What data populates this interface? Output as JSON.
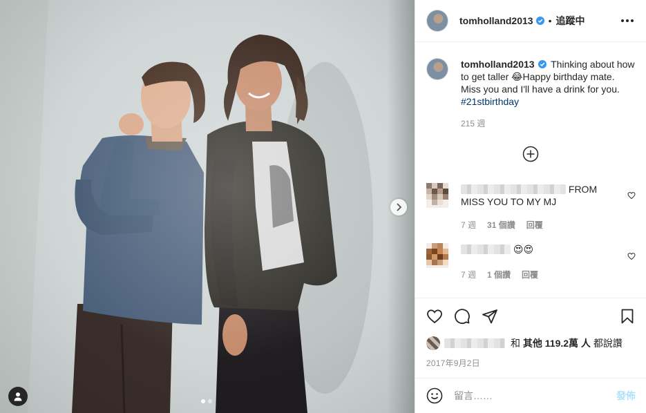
{
  "post": {
    "username": "tomholland2013",
    "follow_status": "追蹤中",
    "separator": "•",
    "verified": true
  },
  "caption": {
    "username": "tomholland2013",
    "text": "Thinking about how to get taller 😂Happy birthday mate. Miss you and I'll have a drink for you.",
    "hashtag": "#21stbirthday",
    "time": "215 週"
  },
  "comments": [
    {
      "text_suffix": "FROM",
      "text_line2": "MISS YOU TO MY MJ",
      "time": "7 週",
      "likes": "31 個讚",
      "reply": "回覆"
    },
    {
      "text_suffix": "😍😍",
      "time": "7 週",
      "likes": "1 個讚",
      "reply": "回覆"
    }
  ],
  "likes": {
    "prefix": "和",
    "others": "其他 119.2萬 人",
    "suffix": "都說讚"
  },
  "date": "2017年9月2日",
  "comment_input": {
    "placeholder": "留言……",
    "post_label": "發佈"
  },
  "carousel": {
    "slide_count": 2,
    "active_index": 0
  },
  "colors": {
    "verified_blue": "#3897f0",
    "hashtag": "#00376b",
    "muted": "#8e8e8e",
    "post_disabled": "#b2dffc"
  },
  "icons": [
    "verified-icon",
    "more-options-icon",
    "load-more-icon",
    "heart-icon",
    "comment-icon",
    "share-icon",
    "bookmark-icon",
    "emoji-icon",
    "chevron-right-icon",
    "user-tag-icon"
  ]
}
